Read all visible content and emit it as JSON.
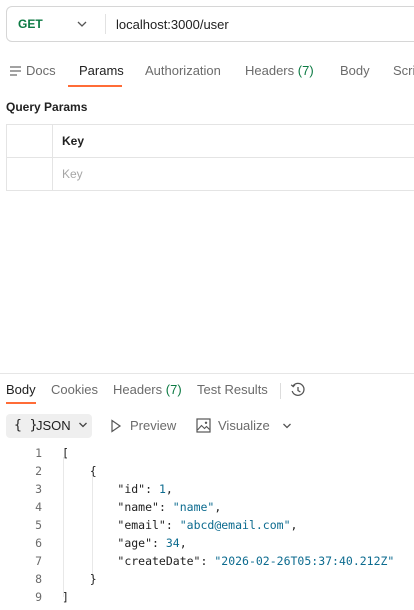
{
  "request": {
    "method": "GET",
    "url": "localhost:3000/user",
    "colors": {
      "method": "#0c7a43",
      "accent": "#ff6c37"
    }
  },
  "tabs": [
    {
      "label": "Docs",
      "icon": "docs-icon"
    },
    {
      "label": "Params",
      "active": true
    },
    {
      "label": "Authorization"
    },
    {
      "label": "Headers",
      "count": "(7)"
    },
    {
      "label": "Body"
    },
    {
      "label": "Scri"
    }
  ],
  "query_params": {
    "title": "Query Params",
    "key_header": "Key",
    "key_placeholder": "Key"
  },
  "response": {
    "tabs": [
      {
        "label": "Body",
        "active": true
      },
      {
        "label": "Cookies"
      },
      {
        "label": "Headers",
        "count": "(7)"
      },
      {
        "label": "Test Results"
      }
    ],
    "history_icon": "history-icon",
    "format": {
      "braces": "{ }",
      "label": "JSON",
      "chevron": "chevron-down-icon"
    },
    "preview_label": "Preview",
    "visualize_label": "Visualize",
    "lines": [
      {
        "num": "1",
        "text": "["
      },
      {
        "num": "2",
        "text": "    {"
      },
      {
        "num": "3",
        "key": "\"id\"",
        "value": "1",
        "type": "number",
        "trail": ","
      },
      {
        "num": "4",
        "key": "\"name\"",
        "value": "\"name\"",
        "type": "string",
        "trail": ","
      },
      {
        "num": "5",
        "key": "\"email\"",
        "value": "\"abcd@email.com\"",
        "type": "string",
        "trail": ","
      },
      {
        "num": "6",
        "key": "\"age\"",
        "value": "34",
        "type": "number",
        "trail": ","
      },
      {
        "num": "7",
        "key": "\"createDate\"",
        "value": "\"2026-02-26T05:37:40.212Z\"",
        "type": "string",
        "trail": ""
      },
      {
        "num": "8",
        "text": "    }"
      },
      {
        "num": "9",
        "text": "]"
      }
    ]
  }
}
